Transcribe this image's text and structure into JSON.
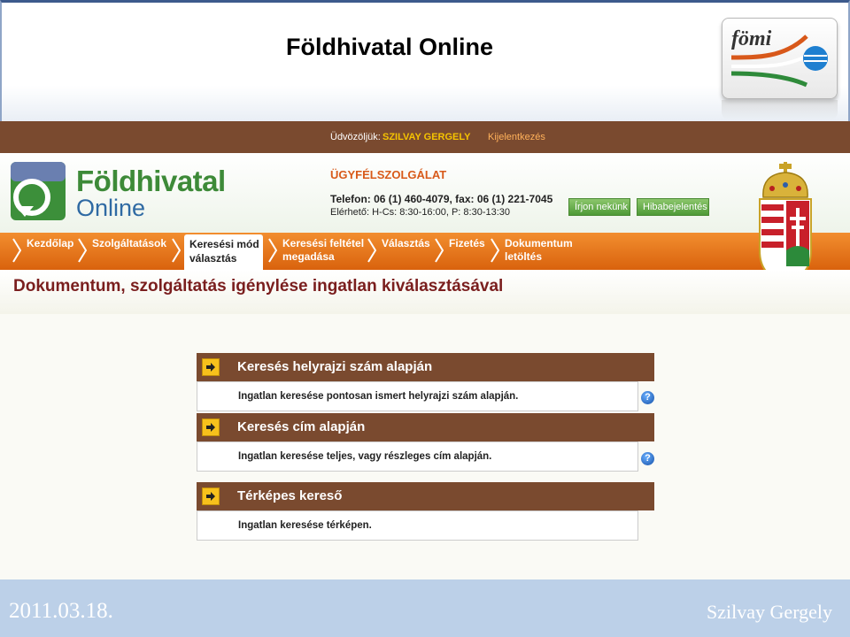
{
  "slide": {
    "title": "Földhivatal Online",
    "logo_text": "fömi",
    "footer_date": "2011.03.18.",
    "footer_author": "Szilvay Gergely"
  },
  "topbar": {
    "welcome": "Üdvözöljük:",
    "user": "SZILVAY GERGELY",
    "logout": "Kijelentkezés"
  },
  "header": {
    "logo_title": "Földhivatal",
    "logo_subtitle": "Online",
    "customer_service": "ÜGYFÉLSZOLGÁLAT",
    "phone": "Telefon: 06 (1) 460-4079, fax: 06 (1) 221-7045",
    "hours": "Elérhető: H-Cs: 8:30-16:00, P: 8:30-13:30",
    "write_btn": "Írjon nekünk",
    "bug_btn": "Hibabejelentés"
  },
  "nav": {
    "items": [
      {
        "label": "Kezdőlap"
      },
      {
        "label": "Szolgáltatások"
      },
      {
        "label": "Keresési mód\nválasztás"
      },
      {
        "label": "Keresési feltétel\nmegadása"
      },
      {
        "label": "Választás"
      },
      {
        "label": "Fizetés"
      },
      {
        "label": "Dokumentum\nletöltés"
      }
    ]
  },
  "page": {
    "heading": "Dokumentum, szolgáltatás igénylése ingatlan kiválasztásával"
  },
  "options": [
    {
      "title": "Keresés helyrajzi szám alapján",
      "desc": "Ingatlan keresése pontosan ismert helyrajzi szám alapján."
    },
    {
      "title": "Keresés cím alapján",
      "desc": "Ingatlan keresése teljes, vagy részleges cím alapján."
    },
    {
      "title": "Térképes kereső",
      "desc": "Ingatlan keresése térképen."
    }
  ],
  "colors": {
    "brown": "#7a4a2f",
    "orange": "#e8761a",
    "green": "#3d8a38",
    "blue": "#2f6aa3",
    "yellow": "#f7c11c"
  }
}
